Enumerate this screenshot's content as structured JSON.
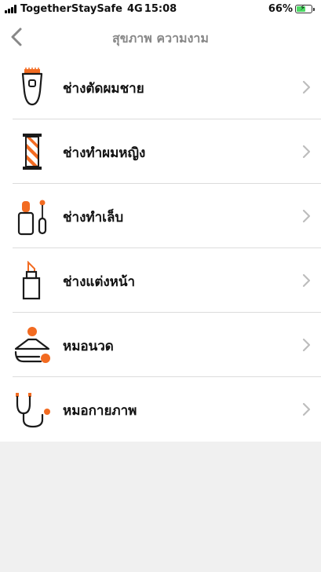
{
  "status_bar": {
    "carrier": "TogetherStaySafe",
    "network": "4G",
    "time": "15:08",
    "battery_percent": "66%",
    "battery_level": 0.66
  },
  "nav": {
    "title": "สุขภาพ ความงาม",
    "back_icon": "chevron-left-icon"
  },
  "colors": {
    "accent": "#f26b21",
    "icon_stroke": "#1a1a1a",
    "chevron": "#bdbdbd",
    "background": "#f0f0f0"
  },
  "items": [
    {
      "label": "ช่างตัดผมชาย",
      "icon": "hair-clipper-icon"
    },
    {
      "label": "ช่างทำผมหญิง",
      "icon": "barber-pole-icon"
    },
    {
      "label": "ช่างทำเล็บ",
      "icon": "nail-polish-icon"
    },
    {
      "label": "ช่างแต่งหน้า",
      "icon": "lipstick-icon"
    },
    {
      "label": "หมอนวด",
      "icon": "massage-icon"
    },
    {
      "label": "หมอกายภาพ",
      "icon": "stethoscope-icon"
    }
  ]
}
